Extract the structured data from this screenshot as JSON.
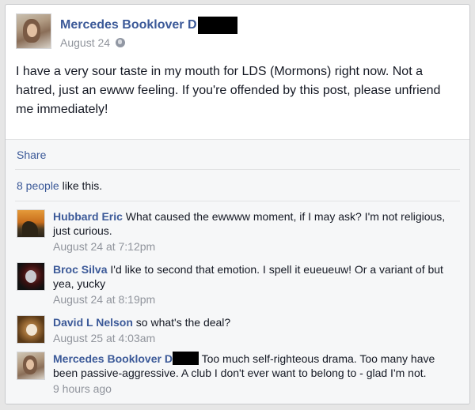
{
  "post": {
    "author": "Mercedes Booklover D",
    "timestamp": "August 24",
    "privacy_icon": "globe-icon",
    "body": "I have a very sour taste in my mouth for LDS (Mormons) right now. Not a hatred, just an ewww feeling. If you're offended by this post, please unfriend me immediately!"
  },
  "actions": {
    "share_label": "Share"
  },
  "likes": {
    "count_text": "8 people",
    "suffix": " like this."
  },
  "comments": [
    {
      "author": "Hubbard Eric",
      "text": "What caused the ewwww moment, if I may ask? I'm not religious, just curious.",
      "time": "August 24 at 7:12pm"
    },
    {
      "author": "Broc Silva",
      "text": "I'd like to second that emotion. I spell it eueueuw! Or a variant of but yea, yucky",
      "time": "August 24 at 8:19pm"
    },
    {
      "author": "David L Nelson",
      "text": "so what's the deal?",
      "time": "August 25 at 4:03am"
    },
    {
      "author": "Mercedes Booklover D",
      "text": "Too much self-righteous drama. Too many have been passive-aggressive. A club I don't ever want to belong to - glad I'm not.",
      "time": "9 hours ago"
    }
  ],
  "colors": {
    "link": "#3b5998",
    "muted": "#90949c",
    "text": "#141823"
  }
}
